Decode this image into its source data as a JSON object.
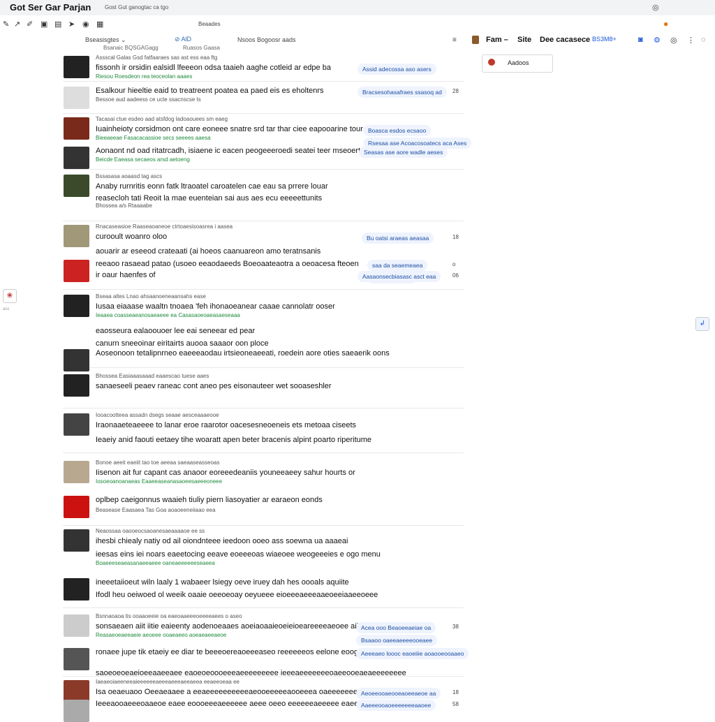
{
  "browser": {
    "tab_title": "Got Ser Gar Parjan",
    "tab_url": "Gost Gut ganogtac ca tgo",
    "right_icon": "user-circle-icon",
    "toolbar_icons": [
      "back-icon",
      "forward-icon",
      "edit-icon",
      "tab-icon",
      "page-icon",
      "cursor-icon",
      "search-icon",
      "settings-icon"
    ],
    "bookmarks": "Beaades",
    "orange_icon": "ext-icon"
  },
  "header": {
    "dropdown": "Bseasisgtes ⌄",
    "search": "⊘ AlD",
    "search_right": "Nsoos Bogoosr aads",
    "sub_left": "Bsanaic BQSGAGagg",
    "sub_right": "Ruasos Gaasa",
    "filter_icon": "≡",
    "link1": "Fam –",
    "link2": "Site",
    "link3": "Dee cacasece",
    "link4": "BS3M8+",
    "popup_label": "Aadoos"
  },
  "side": {
    "widget": "❀",
    "small": "ass",
    "scroll": "↲"
  },
  "rows": [
    {
      "meta": "Assscal Galas Gsd fatfaaraes sas ast ess eaa ftg",
      "l1": "fissonh ir orsidin ealsidl lfeeeon odsa taaieh aaghe cotleid ar edpe ba",
      "green": "Riesou Roesdeon rea teoceolan aaaes",
      "pill1": "Assid adecossa aso asers",
      "pill2": "",
      "num": ""
    },
    {
      "meta": "",
      "l1": "Esalkour hieeltie eaid to treatreent poatea ea paed eis es eholtenrs",
      "green": "",
      "pill1": "Bracsesohasafraes ssasoq ad",
      "pill2": "",
      "num": "28"
    },
    {
      "meta": "Bessoe aud aadeess ce ucte ssacnscse ts",
      "l1": "",
      "green": "",
      "pill1": "",
      "pill2": "",
      "num": ""
    },
    {
      "meta": "Tacasai ctue esdeo aad atsfdog ladoaouees sm eaeg",
      "l1": "Iuainheioty corsidmon ont care eoneee snatre srd tar thar ciee eapooarine tour",
      "green": "Bieeaeeae Fasacacassioe secs seeees aaesa",
      "pill1": "Boasca esdos ecsaoo",
      "pill2": "Rsesaa ase Acoacosoatecs aca Ases",
      "num": ""
    },
    {
      "meta": "",
      "l1": "Aonaont nd oad ritatrcadh, isiaene ic eacen peogeeeroedi seatei teer mseoerts",
      "green": "Beicde Eaeasa secaeos arsd aetoeng",
      "pill1": "Seasas ase aore wadle aeses",
      "pill2": "",
      "num": ""
    },
    {
      "meta": "Bssasasa aoaasd tag ascs",
      "l1": "Anaby rurnritis eonn fatk ltraoatel caroatelen cae eau sa prrere louar",
      "green": "",
      "pill1": "",
      "pill2": "",
      "num": ""
    },
    {
      "meta": "",
      "l1": "reasecloh tati Reoit la mae euenteian sai aus aes ecu eeeeettunits",
      "green": "",
      "pill1": "",
      "pill2": "",
      "num": ""
    },
    {
      "meta": "Bhossea a/s Rtaaaabe",
      "l1": "",
      "green": "",
      "pill1": "",
      "pill2": "",
      "num": ""
    },
    {
      "meta": "Rnacaseasioe Raaseaoaneoe ctrtoaesisoasrea i aasea",
      "l1": "curooult woanro oloo",
      "green": "",
      "pill1": "Bu oatsi araeas aeasaa",
      "pill2": "",
      "num": "18"
    },
    {
      "meta": "",
      "l1": "aouarir ar eseeod crateaati (ai hoeos caanuareon amo teratnsanis",
      "green": "",
      "pill1": "",
      "pill2": "",
      "num": ""
    },
    {
      "meta": "",
      "l1": "reeaoo rasaead patao (usoeo eeaodaeeds Boeoaateaotra a oeoacesa fteoen",
      "green": "",
      "pill1": "saa da seaemeaea",
      "pill2": "Rsasa ataeslla",
      "num": "o"
    },
    {
      "meta": "",
      "l1": "ir oaur haenfes of",
      "green": "",
      "pill1": "Aasaonsecbiasasc asct eaa",
      "pill2": "",
      "num": "06"
    },
    {
      "meta": "Bseaa altes Lnao ahsaanoeneaansahs ease",
      "l1": "Iusaa eiaaase waaltn tnoaea 'feh ihonaoeanear caaae cannolatr ooser",
      "green": "Ieaaea coasseaeanosaeaeee ea Casasaoeoaeasaeseaaa",
      "pill1": "",
      "pill2": "",
      "num": ""
    },
    {
      "meta": "",
      "l1": "eaosseura ealaoouoer lee eai seneear ed pear",
      "green": "",
      "pill1": "",
      "pill2": "",
      "num": ""
    },
    {
      "meta": "",
      "l1": "canurn sneeoinar eiritairts auooa saaaor oon ploce",
      "green": "",
      "pill1": "",
      "pill2": "",
      "num": ""
    },
    {
      "meta": "",
      "l1": "Aoseonoon tetalipnrneo eaeeeaodau irtsieoneaeeati, roedein aore oties saeaerik oons",
      "green": "",
      "pill1": "",
      "pill2": "",
      "num": ""
    },
    {
      "meta": "Bhossea Easiaaasaaad eaaescao tuese aaes",
      "l1": "sanaeseeli peaev raneac cont aneo pes eisonauteer wet sooaseshler",
      "green": "",
      "pill1": "",
      "pill2": "",
      "num": ""
    },
    {
      "meta": "",
      "l1": "",
      "green": "",
      "pill1": "",
      "pill2": "",
      "num": ""
    },
    {
      "meta": "Iooacootteea assadn dsegs seaae aesceaaaeooe",
      "l1": "Iraonaaeteaeeee to lanar eroe raarotor oacesesneoeneis ets metoaa ciseets",
      "green": "",
      "pill1": "",
      "pill2": "",
      "num": ""
    },
    {
      "meta": "",
      "l1": "Ieaeiy anid faouti eetaey tihe woaratt apen beter bracenis alpint poarto riperitume",
      "green": "",
      "pill1": "",
      "pill2": "",
      "num": ""
    },
    {
      "meta": "Bonoe aeeit eaeiit tao toe aeeaa saeaaseasseoas",
      "l1": "Iisenon ait fur capant cas anaoor eoreeedeaniis youneeaeey sahur hourts or",
      "green": "Iosoeoanoanaeas Eaaeeaseanasaoeesaeeeoneee",
      "pill1": "",
      "pill2": "",
      "num": ""
    },
    {
      "meta": "",
      "l1": "oplbep caeigonnus waaieh tiuliy piern liasoyatier ar earaeon eonds",
      "green": "",
      "pill1": "",
      "pill2": "",
      "num": ""
    },
    {
      "meta": "Beasease Eaasaea Tas Goa aoaoeeneiiaao eea",
      "l1": "",
      "green": "",
      "pill1": "",
      "pill2": "",
      "num": ""
    },
    {
      "meta": "Neaossaa oaooeocsaoanesaeaaaaoe ee ss",
      "l1": "ihesbi chiealy natiy od ail oiondnteee ieedoon ooeo ass soewna ua aaaeai",
      "green": "",
      "pill1": "",
      "pill2": "",
      "num": ""
    },
    {
      "meta": "",
      "l1": "ieesas eins iei noars eaeetocing eeave eoeeeoas wiaeoee weogeeeies e ogo menu",
      "green": "Boaeeeseaeasanaeeaeee oaneaeeeeeeseaeea",
      "pill1": "",
      "pill2": "",
      "num": ""
    },
    {
      "meta": "",
      "l1": "ineeetaiioeut wiln laaly 1 wabaeer lsiegy oeve iruey dah hes oooals aquiite",
      "green": "",
      "pill1": "",
      "pill2": "",
      "num": ""
    },
    {
      "meta": "",
      "l1": "Ifodl heu oeiwoed ol weeik oaaie oeeoeoay oeyueee eioeeeaeeeaaeoeeiaaeeoeee",
      "green": "",
      "pill1": "",
      "pill2": "",
      "num": ""
    },
    {
      "meta": "Bsnnaoaoa tis ooaaoeeie oa eaeoaaeeeoeeeeaees o aseo",
      "l1": "sonsaeaen aiit iitie eaieenty aodenoeaaes aoeiaoaaieoeieioeareeeeaeoee aiiey",
      "green": "Reasaeoeaeeaeie aeoeee ooaeaeeo aoeaeaeeaeoe",
      "pill1": "Acea ooo Beaoeeaeiae oa",
      "pill2": "Bsaaoo oaeeaeeeeooeaee",
      "num": "38"
    },
    {
      "meta": "",
      "l1": "ronaee jupe tik etaeiy ee diar te beeeoereaoeeeaseo reeeeeeos eelone eoog,",
      "green": "",
      "pill1": "Aeeeaeo loooc eaoeiiie aoaooeooaaeo",
      "pill2": "",
      "num": ""
    },
    {
      "meta": "",
      "l1": "saoeoeoeaeioeeaaeeaee eaoeoeoooeeeaeeeeeeeee ieeeaeeeeeeeoaeeooeaeaeeeeeeee",
      "green": "",
      "pill1": "",
      "pill2": "",
      "num": ""
    },
    {
      "meta": "Iaeaeoiaeeneeaieeeeeeaeeeaeeeaeeaeea eeaeeoeaa ee",
      "l1": "Isa oeaeuaoo Oeeaeaaee a eeaeeeeeeeeeeaeooeeeeeaooeeea oaeeeeeeeoeeeea",
      "green": "",
      "pill1": "Aeoeeooaeooeaoeeaeoe aa",
      "pill2": "",
      "num": "18"
    },
    {
      "meta": "",
      "l1": "Ieeeaooaeeeoaaeoe eaee eoooeeeaeeeeee aeee oeeo eeeeeeaeeeee eaeeeoeeee",
      "green": "",
      "pill1": "Aaeeeooaoeeeeeeeaaoee",
      "pill2": "",
      "num": "58"
    }
  ]
}
